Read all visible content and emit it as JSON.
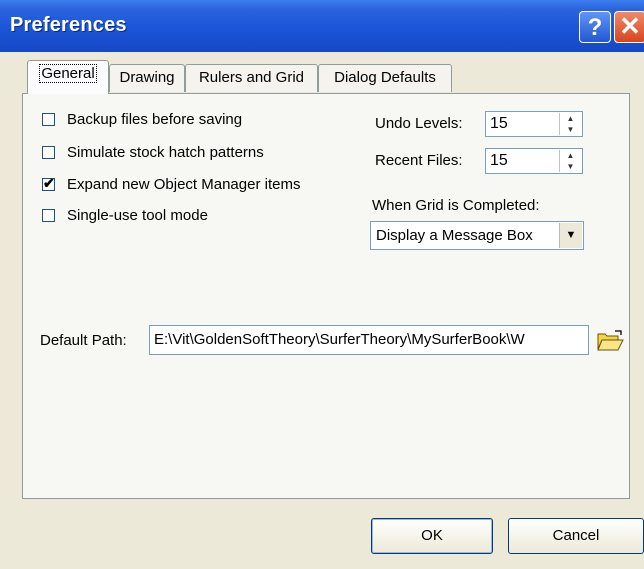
{
  "window": {
    "title": "Preferences",
    "help_icon": "?",
    "close_icon": "✕"
  },
  "tabs": [
    {
      "label": "General",
      "active": true
    },
    {
      "label": "Drawing",
      "active": false
    },
    {
      "label": "Rulers and Grid",
      "active": false
    },
    {
      "label": "Dialog Defaults",
      "active": false
    }
  ],
  "general": {
    "checkboxes": [
      {
        "label": "Backup files before saving",
        "checked": false
      },
      {
        "label": "Simulate stock hatch patterns",
        "checked": false
      },
      {
        "label": "Expand new Object Manager items",
        "checked": true
      },
      {
        "label": "Single-use tool mode",
        "checked": false
      }
    ],
    "undo_levels": {
      "label": "Undo Levels:",
      "value": "15"
    },
    "recent_files": {
      "label": "Recent Files:",
      "value": "15"
    },
    "grid_completed": {
      "label": "When Grid is Completed:",
      "value": "Display a Message Box"
    },
    "default_path": {
      "label": "Default Path:",
      "value": "E:\\Vit\\GoldenSoftTheory\\SurferTheory\\MySurferBook\\W"
    }
  },
  "buttons": {
    "ok": "OK",
    "cancel": "Cancel"
  }
}
